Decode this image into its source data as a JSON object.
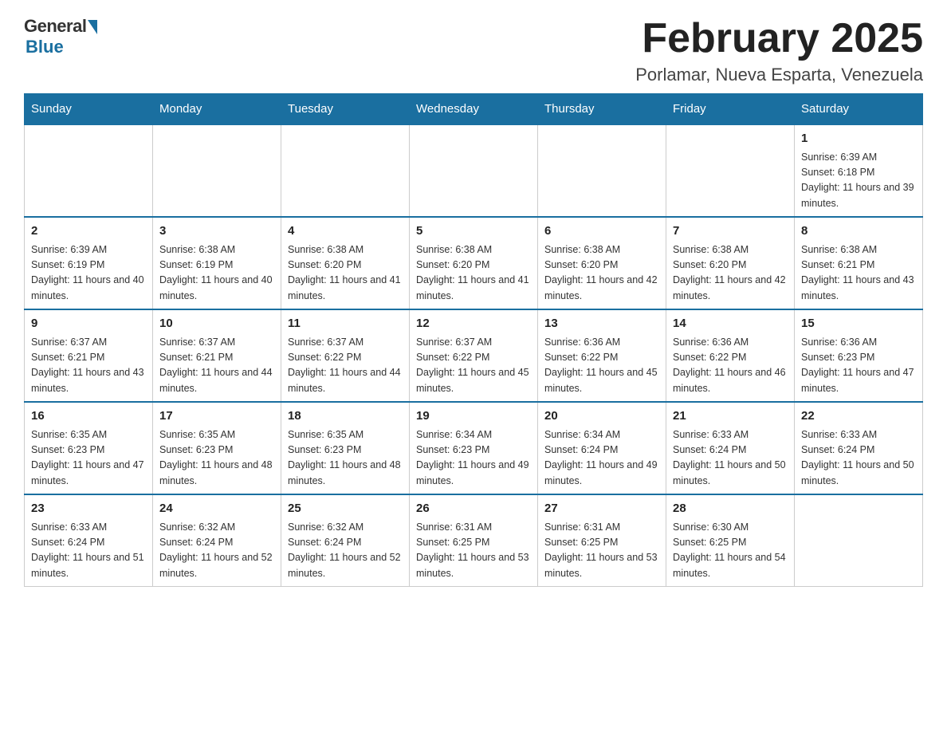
{
  "header": {
    "logo_general": "General",
    "logo_blue": "Blue",
    "month_title": "February 2025",
    "location": "Porlamar, Nueva Esparta, Venezuela"
  },
  "days_of_week": [
    "Sunday",
    "Monday",
    "Tuesday",
    "Wednesday",
    "Thursday",
    "Friday",
    "Saturday"
  ],
  "weeks": [
    [
      {
        "day": "",
        "info": ""
      },
      {
        "day": "",
        "info": ""
      },
      {
        "day": "",
        "info": ""
      },
      {
        "day": "",
        "info": ""
      },
      {
        "day": "",
        "info": ""
      },
      {
        "day": "",
        "info": ""
      },
      {
        "day": "1",
        "info": "Sunrise: 6:39 AM\nSunset: 6:18 PM\nDaylight: 11 hours and 39 minutes."
      }
    ],
    [
      {
        "day": "2",
        "info": "Sunrise: 6:39 AM\nSunset: 6:19 PM\nDaylight: 11 hours and 40 minutes."
      },
      {
        "day": "3",
        "info": "Sunrise: 6:38 AM\nSunset: 6:19 PM\nDaylight: 11 hours and 40 minutes."
      },
      {
        "day": "4",
        "info": "Sunrise: 6:38 AM\nSunset: 6:20 PM\nDaylight: 11 hours and 41 minutes."
      },
      {
        "day": "5",
        "info": "Sunrise: 6:38 AM\nSunset: 6:20 PM\nDaylight: 11 hours and 41 minutes."
      },
      {
        "day": "6",
        "info": "Sunrise: 6:38 AM\nSunset: 6:20 PM\nDaylight: 11 hours and 42 minutes."
      },
      {
        "day": "7",
        "info": "Sunrise: 6:38 AM\nSunset: 6:20 PM\nDaylight: 11 hours and 42 minutes."
      },
      {
        "day": "8",
        "info": "Sunrise: 6:38 AM\nSunset: 6:21 PM\nDaylight: 11 hours and 43 minutes."
      }
    ],
    [
      {
        "day": "9",
        "info": "Sunrise: 6:37 AM\nSunset: 6:21 PM\nDaylight: 11 hours and 43 minutes."
      },
      {
        "day": "10",
        "info": "Sunrise: 6:37 AM\nSunset: 6:21 PM\nDaylight: 11 hours and 44 minutes."
      },
      {
        "day": "11",
        "info": "Sunrise: 6:37 AM\nSunset: 6:22 PM\nDaylight: 11 hours and 44 minutes."
      },
      {
        "day": "12",
        "info": "Sunrise: 6:37 AM\nSunset: 6:22 PM\nDaylight: 11 hours and 45 minutes."
      },
      {
        "day": "13",
        "info": "Sunrise: 6:36 AM\nSunset: 6:22 PM\nDaylight: 11 hours and 45 minutes."
      },
      {
        "day": "14",
        "info": "Sunrise: 6:36 AM\nSunset: 6:22 PM\nDaylight: 11 hours and 46 minutes."
      },
      {
        "day": "15",
        "info": "Sunrise: 6:36 AM\nSunset: 6:23 PM\nDaylight: 11 hours and 47 minutes."
      }
    ],
    [
      {
        "day": "16",
        "info": "Sunrise: 6:35 AM\nSunset: 6:23 PM\nDaylight: 11 hours and 47 minutes."
      },
      {
        "day": "17",
        "info": "Sunrise: 6:35 AM\nSunset: 6:23 PM\nDaylight: 11 hours and 48 minutes."
      },
      {
        "day": "18",
        "info": "Sunrise: 6:35 AM\nSunset: 6:23 PM\nDaylight: 11 hours and 48 minutes."
      },
      {
        "day": "19",
        "info": "Sunrise: 6:34 AM\nSunset: 6:23 PM\nDaylight: 11 hours and 49 minutes."
      },
      {
        "day": "20",
        "info": "Sunrise: 6:34 AM\nSunset: 6:24 PM\nDaylight: 11 hours and 49 minutes."
      },
      {
        "day": "21",
        "info": "Sunrise: 6:33 AM\nSunset: 6:24 PM\nDaylight: 11 hours and 50 minutes."
      },
      {
        "day": "22",
        "info": "Sunrise: 6:33 AM\nSunset: 6:24 PM\nDaylight: 11 hours and 50 minutes."
      }
    ],
    [
      {
        "day": "23",
        "info": "Sunrise: 6:33 AM\nSunset: 6:24 PM\nDaylight: 11 hours and 51 minutes."
      },
      {
        "day": "24",
        "info": "Sunrise: 6:32 AM\nSunset: 6:24 PM\nDaylight: 11 hours and 52 minutes."
      },
      {
        "day": "25",
        "info": "Sunrise: 6:32 AM\nSunset: 6:24 PM\nDaylight: 11 hours and 52 minutes."
      },
      {
        "day": "26",
        "info": "Sunrise: 6:31 AM\nSunset: 6:25 PM\nDaylight: 11 hours and 53 minutes."
      },
      {
        "day": "27",
        "info": "Sunrise: 6:31 AM\nSunset: 6:25 PM\nDaylight: 11 hours and 53 minutes."
      },
      {
        "day": "28",
        "info": "Sunrise: 6:30 AM\nSunset: 6:25 PM\nDaylight: 11 hours and 54 minutes."
      },
      {
        "day": "",
        "info": ""
      }
    ]
  ]
}
